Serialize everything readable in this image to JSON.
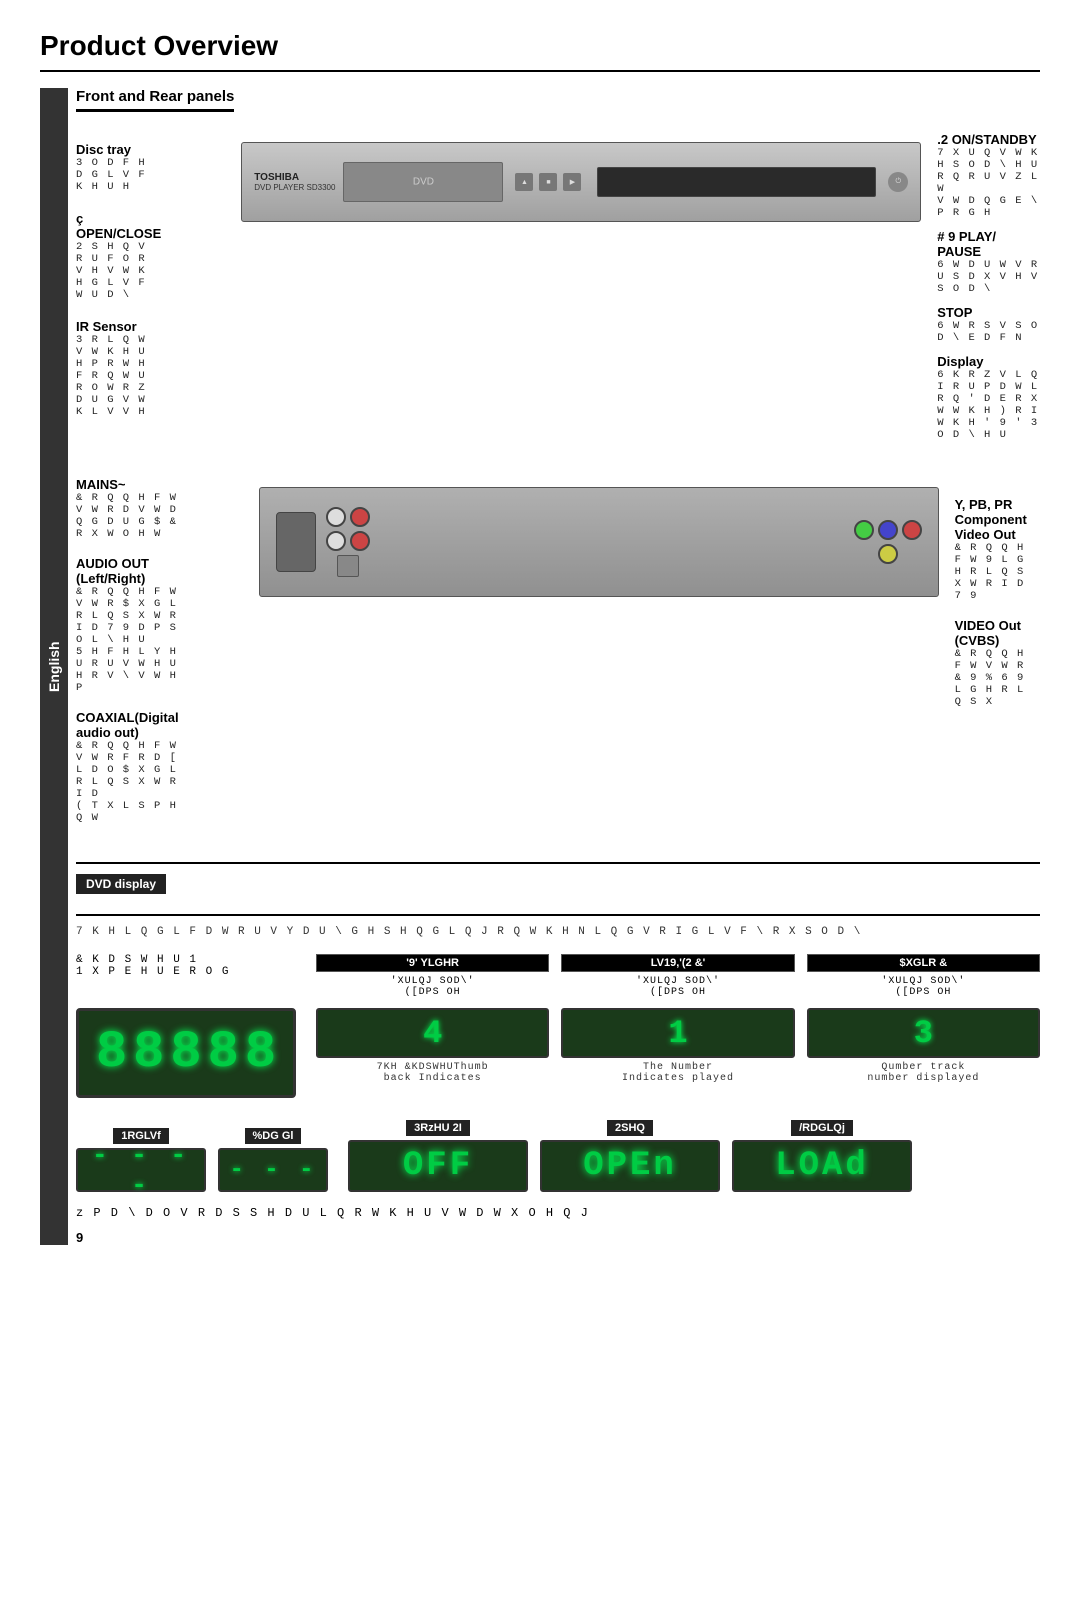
{
  "page": {
    "title": "Product Overview",
    "language_tab": "English",
    "page_number": "9"
  },
  "front_section": {
    "section_label": "Front and Rear panels",
    "left_labels": [
      {
        "title": "Disc tray",
        "desc": "3 O D F H  D  G L V F  K H U H"
      },
      {
        "title": "ç  OPEN/CLOSE",
        "desc": "2 S H Q  V  R U  F O R V H V  W K H  G L V F  W U D \\"
      },
      {
        "title": "IR Sensor",
        "desc": "3 R L Q W V  W K H  U H P R W H  F R Q W U R O  W R Z D U G V  W K L V  V H"
      }
    ],
    "right_labels": [
      {
        "title": ".2  ON/STANDBY",
        "desc": "7 X U Q V  W K H  S O D \\ H U  R Q  R U  V Z L W",
        "desc2": "V W D Q G E \\  P R G H"
      },
      {
        "title": "#  9 PLAY/ PAUSE",
        "desc": "6 W D U W V  R U  S D X V H V  S O D \\"
      },
      {
        "title": "STOP",
        "desc": "6 W R S V  S O D \\ E D F N"
      },
      {
        "title": "Display",
        "desc": "6 K R Z V  L Q I R U P D W L R Q  ' D E R X W  W K H  )  R I  W K H  ' 9 '  3 O D \\ H U"
      }
    ],
    "device": {
      "brand": "TOSHIBA",
      "model": "DVD PLAYER SD3300"
    }
  },
  "rear_section": {
    "left_labels": [
      {
        "title": "MAINS~",
        "desc": "& R Q Q H F W V  W R  D  V W D Q G D U G  $ &  R X W O H W"
      },
      {
        "title": "AUDIO OUT (Left/Right)",
        "desc": "& R Q Q H F W V  W R  $ X G L R  L Q S X W  R I  D  7 9  D P S O L \\ H U",
        "desc2": "5 H F H L Y H U  R U  V W H U H R  V \\ V W H P"
      },
      {
        "title": "COAXIAL(Digital audio out)",
        "desc": "& R Q Q H F W V  W R  F R D [ L D O  $ X G L R  L Q S X W  R I  D",
        "desc2": "( T X L S P H Q W"
      }
    ],
    "right_labels": [
      {
        "title": "Y, PB, PR Component Video Out",
        "desc": "& R Q Q H F W  9 L G H R  L Q S X W  R I  D  7 9"
      },
      {
        "title": "VIDEO Out (CVBS)",
        "desc": "& R Q Q H F W V  W R  & 9 % 6  9 L G H R  L Q S X"
      }
    ]
  },
  "dvd_display_section": {
    "badge": "DVD display",
    "description": "7 K H  L Q G L F D W R U V  Y D U \\ G H S H Q G L Q J  R Q  W K H  N L Q G V  R I  G L V F  \\ R X  S O D \\",
    "main_display": {
      "digits": "88888"
    },
    "chapter_label": "& K D S W H U  1",
    "number_bold_label": "1 X P E H U  E R O G",
    "columns": [
      {
        "header": "'9' YLGHR",
        "sub1": "'XULQJ SOD\\'",
        "sub2": "([DPS OH",
        "value": "4",
        "desc1": "7KH &KDSWHUThumb",
        "desc2": "back Indicates"
      },
      {
        "header": "LV19,'(2 &'",
        "sub1": "'XULQJ SOD\\'",
        "sub2": "([DPS OH",
        "value": "1",
        "desc1": "The Number",
        "desc2": "Indicates played"
      },
      {
        "header": "$XGLR &",
        "sub1": "'XULQJ SOD\\'",
        "sub2": "([DPS OH",
        "value": "3",
        "desc1": "Qumber track",
        "desc2": "number displayed"
      }
    ],
    "bottom_section": {
      "left_items": [
        {
          "label": "1RGLVf",
          "display": "- - - -"
        },
        {
          "label": "%DG Gl",
          "display": "- - -"
        }
      ],
      "right_items": [
        {
          "label": "3RzHU 2I",
          "display": "OFF"
        },
        {
          "label": "2SHQ",
          "display": "OPEn"
        },
        {
          "label": "/RDGLQj",
          "display": "LOAd"
        }
      ]
    },
    "bottom_note": "z   P D \\ D O V R  D S S H D U  L Q  R W K H U  V W D W X O H  Q J"
  }
}
